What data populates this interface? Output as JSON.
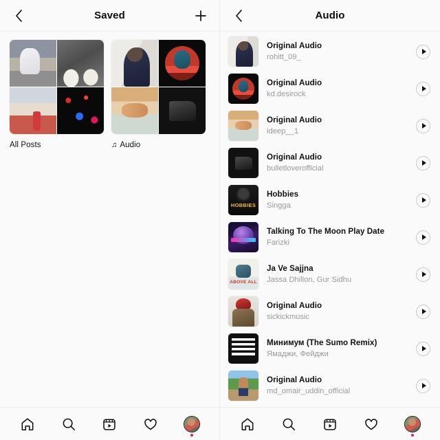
{
  "left_panel": {
    "header": {
      "back_icon": "chevron-left-icon",
      "title": "Saved",
      "add_icon": "plus-icon"
    },
    "collections": [
      {
        "label": "All Posts",
        "has_note_icon": false,
        "note_glyph": "",
        "covers": [
          "p-street",
          "p-shoes",
          "p-bridge",
          "p-neon"
        ]
      },
      {
        "label": "Audio",
        "has_note_icon": true,
        "note_glyph": "♫",
        "covers": [
          "p-rohitt",
          "p-kd",
          "p-ideep",
          "p-bullet"
        ]
      }
    ]
  },
  "right_panel": {
    "header": {
      "back_icon": "chevron-left-icon",
      "title": "Audio"
    },
    "audio_items": [
      {
        "title": "Original Audio",
        "subtitle": "rohitt_09_",
        "art": "p-rohitt",
        "play_icon": "play-icon"
      },
      {
        "title": "Original Audio",
        "subtitle": "kd.desirock",
        "art": "p-kd",
        "play_icon": "play-icon"
      },
      {
        "title": "Original Audio",
        "subtitle": "ideep__1",
        "art": "p-ideep",
        "play_icon": "play-icon"
      },
      {
        "title": "Original Audio",
        "subtitle": "bulletloverofficial",
        "art": "p-bullet",
        "play_icon": "play-icon"
      },
      {
        "title": "Hobbies",
        "subtitle": "Singga",
        "art": "p-hobbies",
        "play_icon": "play-icon"
      },
      {
        "title": "Talking To The Moon Play Date",
        "subtitle": "Farizki",
        "art": "p-moon",
        "play_icon": "play-icon"
      },
      {
        "title": "Ja Ve Sajjna",
        "subtitle": "Jassa Dhillon, Gur Sidhu",
        "art": "p-above",
        "play_icon": "play-icon"
      },
      {
        "title": "Original Audio",
        "subtitle": "sickickmusic",
        "art": "p-sickick",
        "play_icon": "play-icon"
      },
      {
        "title": "Минимум (The Sumo Remix)",
        "subtitle": "Ямаджи, Фейджи",
        "art": "p-minimum",
        "play_icon": "play-icon"
      },
      {
        "title": "Original Audio",
        "subtitle": "md_omair_uddin_official",
        "art": "p-omair",
        "play_icon": "play-icon"
      }
    ]
  },
  "navbar": {
    "items": [
      {
        "name": "home-icon"
      },
      {
        "name": "search-icon"
      },
      {
        "name": "reels-icon"
      },
      {
        "name": "heart-icon"
      },
      {
        "name": "profile-avatar"
      }
    ],
    "notification_dot_color": "#ed1b6d"
  },
  "colors": {
    "background": "#fafafa",
    "text_primary": "#111111",
    "text_secondary": "#9a9a9a",
    "divider": "#ededed"
  }
}
